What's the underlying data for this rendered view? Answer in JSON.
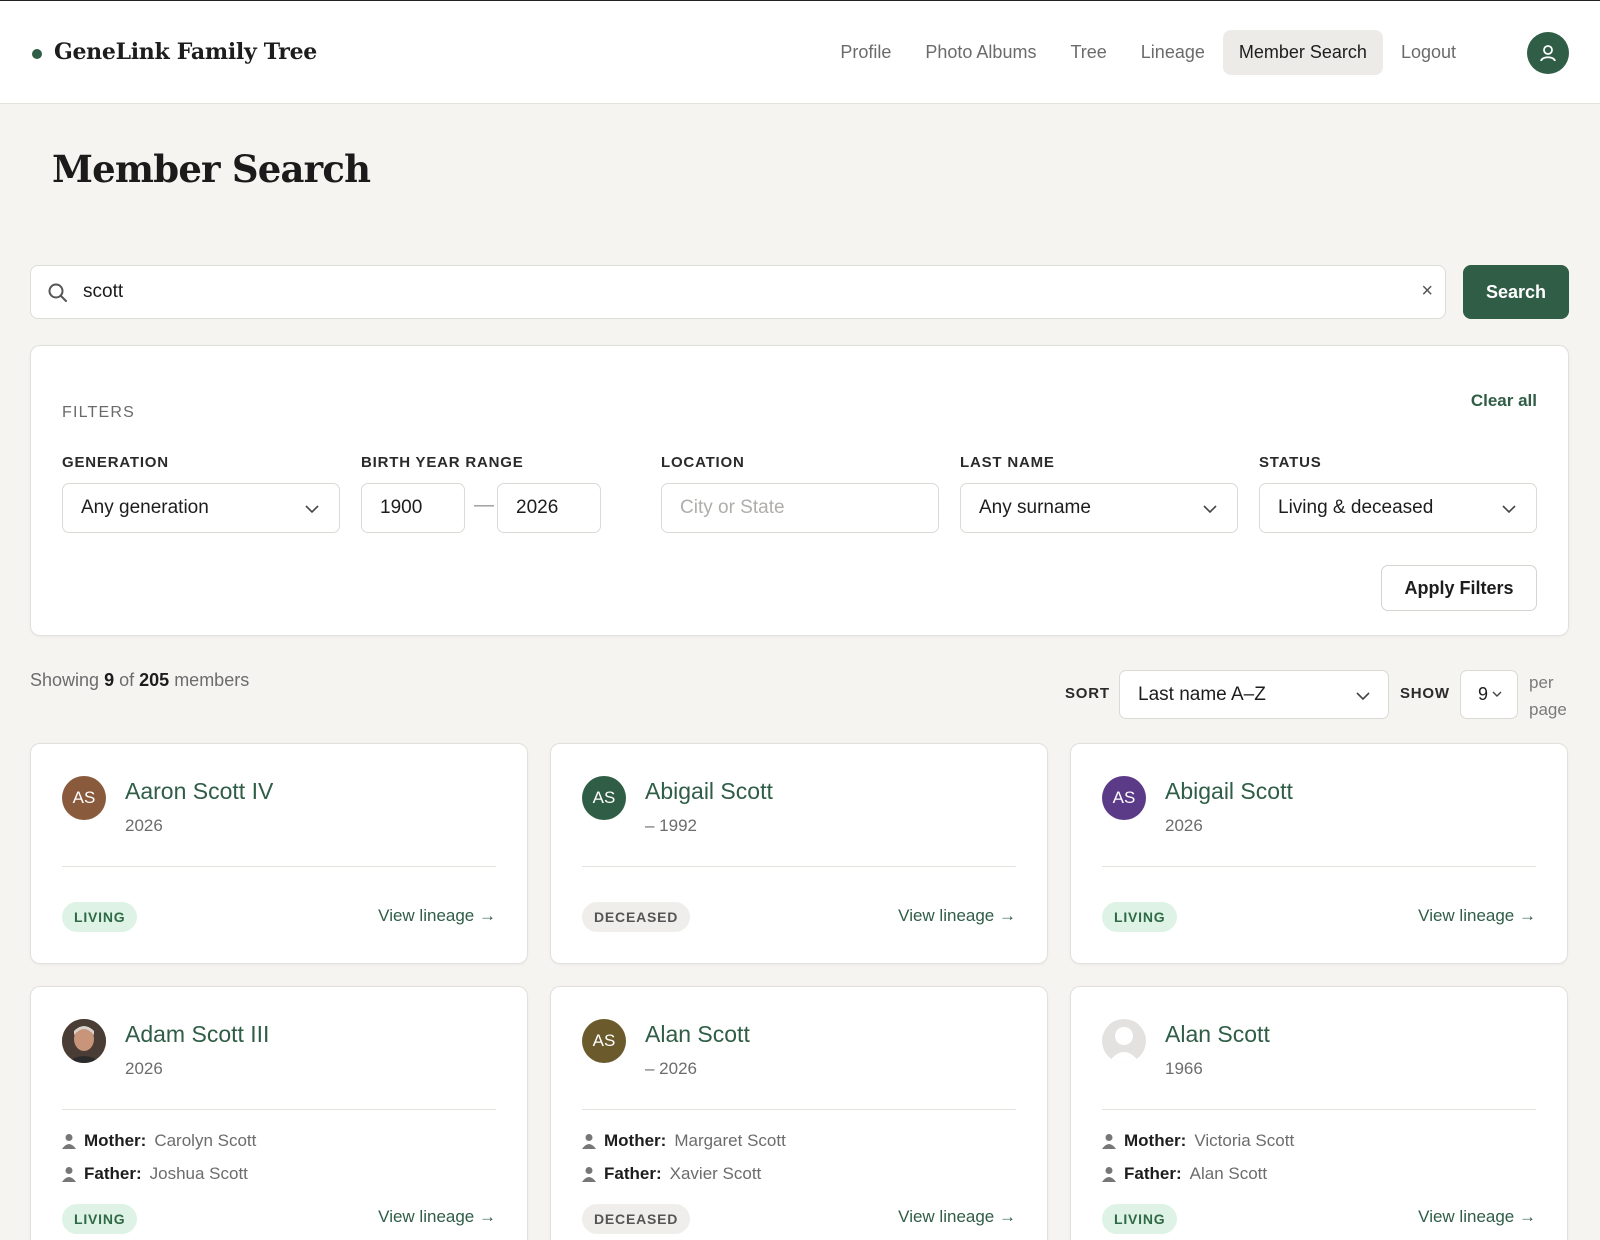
{
  "header": {
    "brand": "GeneLink Family Tree",
    "nav": [
      "Profile",
      "Photo Albums",
      "Tree",
      "Lineage",
      "Member Search",
      "Logout"
    ],
    "active_nav": "Member Search"
  },
  "page_title": "Member Search",
  "search": {
    "value": "scott",
    "clear_label": "×",
    "button_label": "Search"
  },
  "filters": {
    "title": "FILTERS",
    "clear_all": "Clear all",
    "generation_label": "GENERATION",
    "generation_value": "Any generation",
    "birth_year_label": "BIRTH YEAR RANGE",
    "birth_year_from": "1900",
    "birth_year_to": "2026",
    "range_dash": "—",
    "location_label": "LOCATION",
    "location_placeholder": "City or State",
    "last_name_label": "LAST NAME",
    "last_name_value": "Any surname",
    "status_label": "STATUS",
    "status_value": "Living & deceased",
    "apply_label": "Apply Filters"
  },
  "results": {
    "showing_prefix": "Showing",
    "shown": "9",
    "of_text": "of",
    "total": "205",
    "suffix": "members",
    "sort_label": "SORT",
    "sort_value": "Last name A–Z",
    "show_label": "SHOW",
    "show_value": "9",
    "per_page": "per page"
  },
  "members": [
    {
      "initials": "AS",
      "name": "Aaron Scott IV",
      "dates": "2026",
      "status": "LIVING",
      "avatar_color": "#8a5a3c",
      "link": "View lineage →"
    },
    {
      "initials": "AS",
      "name": "Abigail Scott",
      "dates": "– 1992",
      "status": "DECEASED",
      "avatar_color": "#2f5d46",
      "link": "View lineage →"
    },
    {
      "initials": "AS",
      "name": "Abigail Scott",
      "dates": "2026",
      "status": "LIVING",
      "avatar_color": "#5b3a87",
      "link": "View lineage →"
    },
    {
      "initials": "",
      "name": "Adam Scott III",
      "dates": "2026",
      "status": "LIVING",
      "avatar": "photo-portrait",
      "mother_label": "Mother:",
      "mother": "Carolyn Scott",
      "father_label": "Father:",
      "father": "Joshua Scott",
      "link": "View lineage →"
    },
    {
      "initials": "AS",
      "name": "Alan Scott",
      "dates": "– 2026",
      "status": "DECEASED",
      "avatar_color": "#6b5a2c",
      "mother_label": "Mother:",
      "mother": "Margaret Scott",
      "father_label": "Father:",
      "father": "Xavier Scott",
      "link": "View lineage →"
    },
    {
      "initials": "",
      "name": "Alan Scott",
      "dates": "1966",
      "status": "LIVING",
      "avatar": "placeholder-person",
      "mother_label": "Mother:",
      "mother": "Victoria Scott",
      "father_label": "Father:",
      "father": "Alan Scott",
      "link": "View lineage →"
    }
  ]
}
